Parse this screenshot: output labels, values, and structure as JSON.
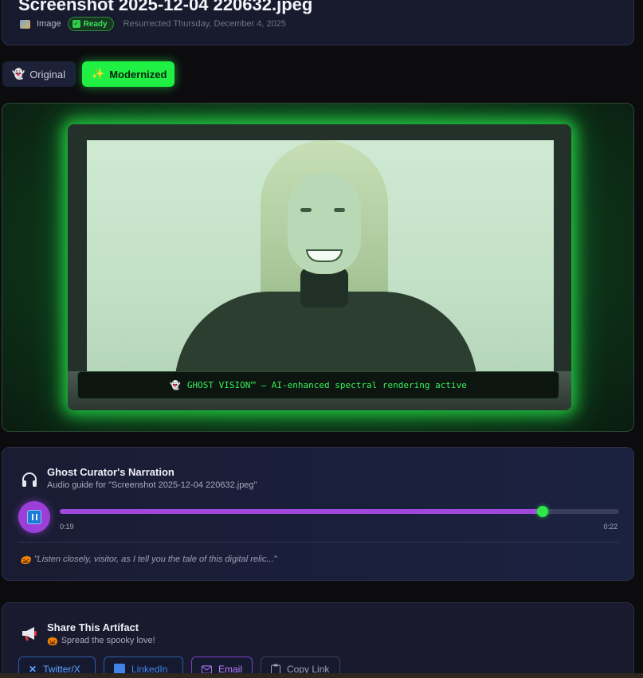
{
  "header": {
    "title": "Screenshot 2025-12-04 220632.jpeg",
    "type_label": "Image",
    "status_badge": "Ready",
    "resurrected": "Resurrected Thursday, December 4, 2025"
  },
  "toggle": {
    "original_label": "Original",
    "modernized_label": "Modernized",
    "active": "Modernized"
  },
  "viewer": {
    "caption": "GHOST VISION™ — AI-enhanced spectral rendering active"
  },
  "narration": {
    "title": "Ghost Curator's Narration",
    "subtitle": "Audio guide for \"Screenshot 2025-12-04 220632.jpeg\"",
    "current_time": "0:19",
    "total_time": "0:22",
    "progress_fraction": 0.8636,
    "quote": "\"Listen closely, visitor, as I tell you the tale of this digital relic...\""
  },
  "share": {
    "title": "Share This Artifact",
    "subtitle": "Spread the spooky love!",
    "buttons": {
      "twitter": "Twitter/X",
      "linkedin": "LinkedIn",
      "email": "Email",
      "copy": "Copy Link"
    }
  },
  "colors": {
    "accent_green": "#1ff043",
    "accent_purple": "#a048dc",
    "card_bg": "#181a2e"
  },
  "icons": {
    "type": "image-icon",
    "badge": "check-icon",
    "ghost": "ghost-icon",
    "headphones": "headphones-icon",
    "pause": "pause-icon",
    "pumpkin": "pumpkin-icon",
    "megaphone": "megaphone-icon"
  }
}
